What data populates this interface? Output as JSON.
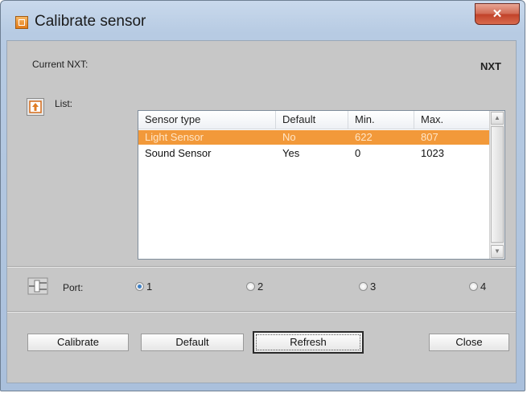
{
  "window": {
    "title": "Calibrate sensor",
    "close_glyph": "✕"
  },
  "current_nxt": {
    "label": "Current NXT:",
    "value": "NXT"
  },
  "list": {
    "label": "List:",
    "columns": [
      "Sensor type",
      "Default",
      "Min.",
      "Max."
    ],
    "rows": [
      {
        "sensor_type": "Light Sensor",
        "default": "No",
        "min": "622",
        "max": "807",
        "selected": true
      },
      {
        "sensor_type": "Sound Sensor",
        "default": "Yes",
        "min": "0",
        "max": "1023",
        "selected": false
      }
    ],
    "selection_color": "#f2993a"
  },
  "port": {
    "label": "Port:",
    "options": [
      "1",
      "2",
      "3",
      "4"
    ],
    "selected": "1"
  },
  "buttons": {
    "calibrate": "Calibrate",
    "default": "Default",
    "refresh": "Refresh",
    "close": "Close"
  },
  "icons": {
    "app": "app-icon",
    "close": "close-icon",
    "list": "upload-arrow-icon",
    "port": "plug-icon"
  }
}
